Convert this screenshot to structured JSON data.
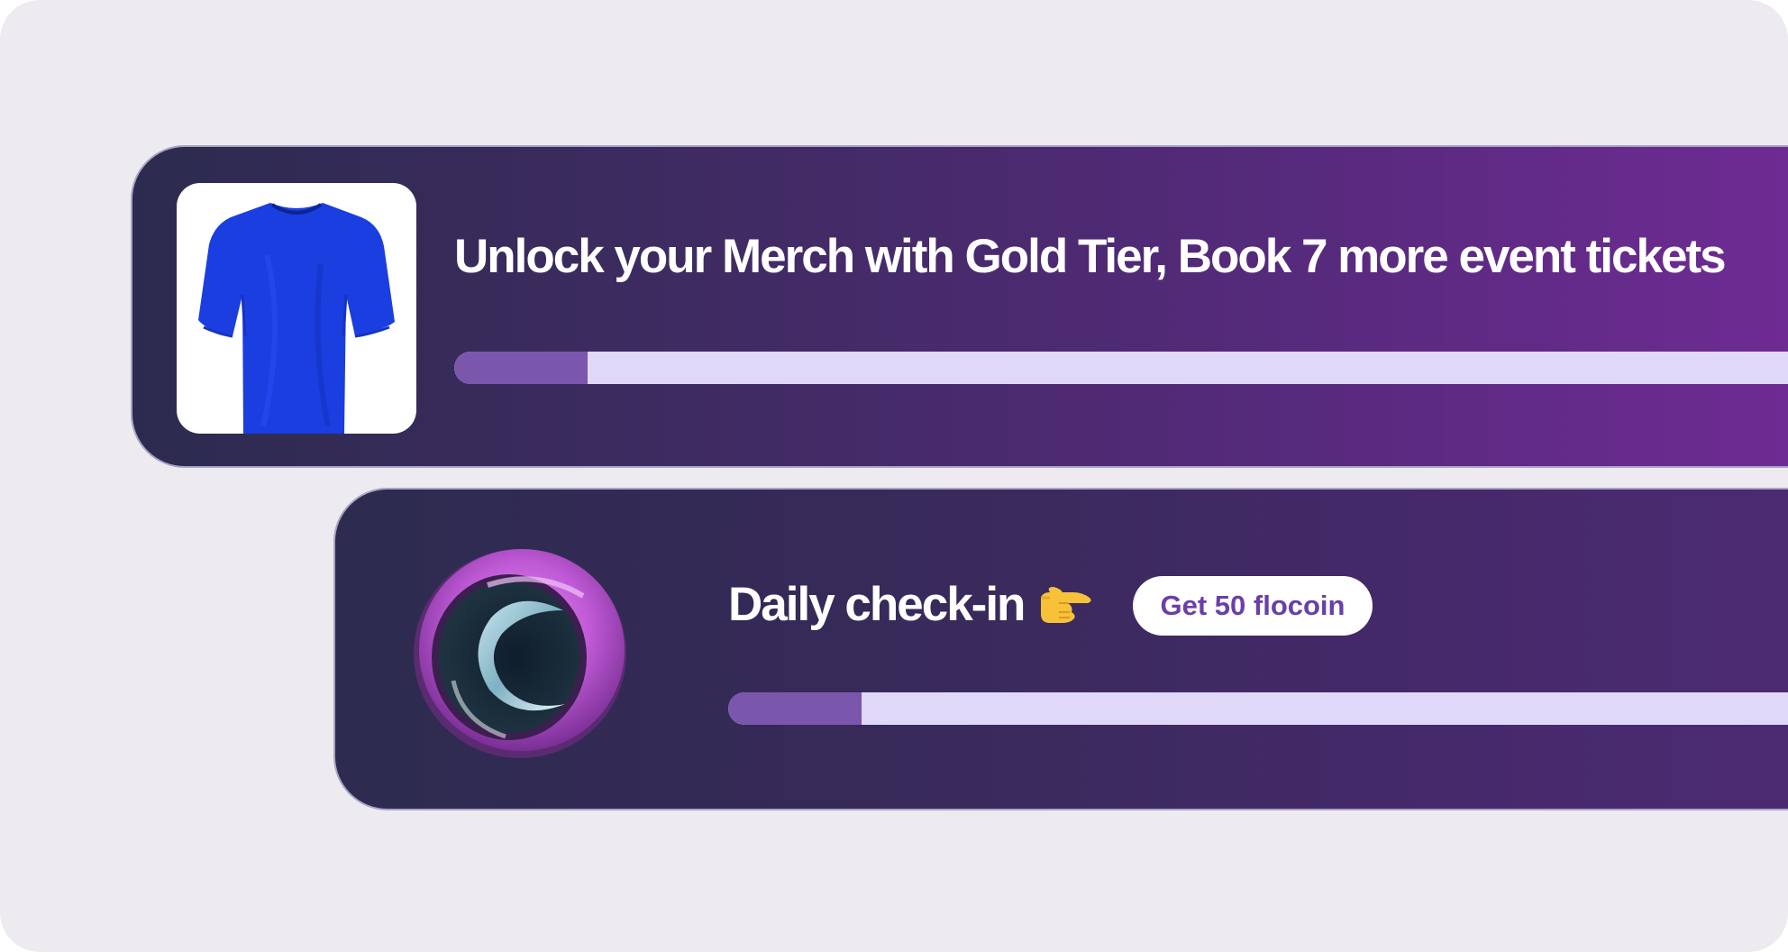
{
  "merch_card": {
    "image_icon": "blue-tshirt-icon",
    "headline": "Unlock your Merch with Gold Tier, Book 7 more event tickets",
    "progress": 0.1
  },
  "checkin_card": {
    "image_icon": "flocoin-icon",
    "headline": "Daily check-in",
    "emoji_icon": "pointing-right-hand-icon",
    "cta_label": "Get 50 flocoin",
    "progress": 0.126
  },
  "colors": {
    "background": "#edebef",
    "progress_fill": "#7a57ad",
    "progress_track": "#e0d8f8",
    "cta_text": "#6a3fa8",
    "tshirt": "#1a3ee0",
    "coin_purple": "#c25ad6"
  }
}
